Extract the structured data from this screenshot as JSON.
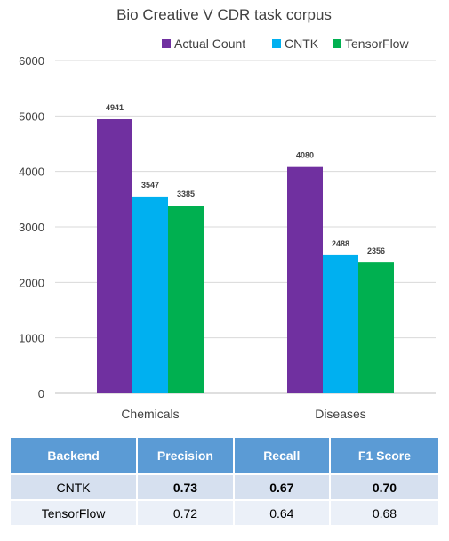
{
  "chart_data": {
    "type": "bar",
    "title": "Bio Creative V CDR task corpus",
    "categories": [
      "Chemicals",
      "Diseases"
    ],
    "series": [
      {
        "name": "Actual Count",
        "values": [
          4941,
          4080
        ],
        "color": "#7030a0"
      },
      {
        "name": "CNTK",
        "values": [
          3547,
          2488
        ],
        "color": "#00b0f0"
      },
      {
        "name": "TensorFlow",
        "values": [
          3385,
          2356
        ],
        "color": "#00b050"
      }
    ],
    "ylim": [
      0,
      6000
    ],
    "yticks": [
      0,
      1000,
      2000,
      3000,
      4000,
      5000,
      6000
    ],
    "grid": true,
    "legend": "top-right",
    "data_labels": true
  },
  "table": {
    "headers": [
      "Backend",
      "Precision",
      "Recall",
      "F1 Score"
    ],
    "rows": [
      {
        "cells": [
          "CNTK",
          "0.73",
          "0.67",
          "0.70"
        ],
        "bold": [
          false,
          true,
          true,
          true
        ]
      },
      {
        "cells": [
          "TensorFlow",
          "0.72",
          "0.64",
          "0.68"
        ],
        "bold": [
          false,
          false,
          false,
          false
        ]
      }
    ],
    "header_color": "#5b9bd5"
  }
}
